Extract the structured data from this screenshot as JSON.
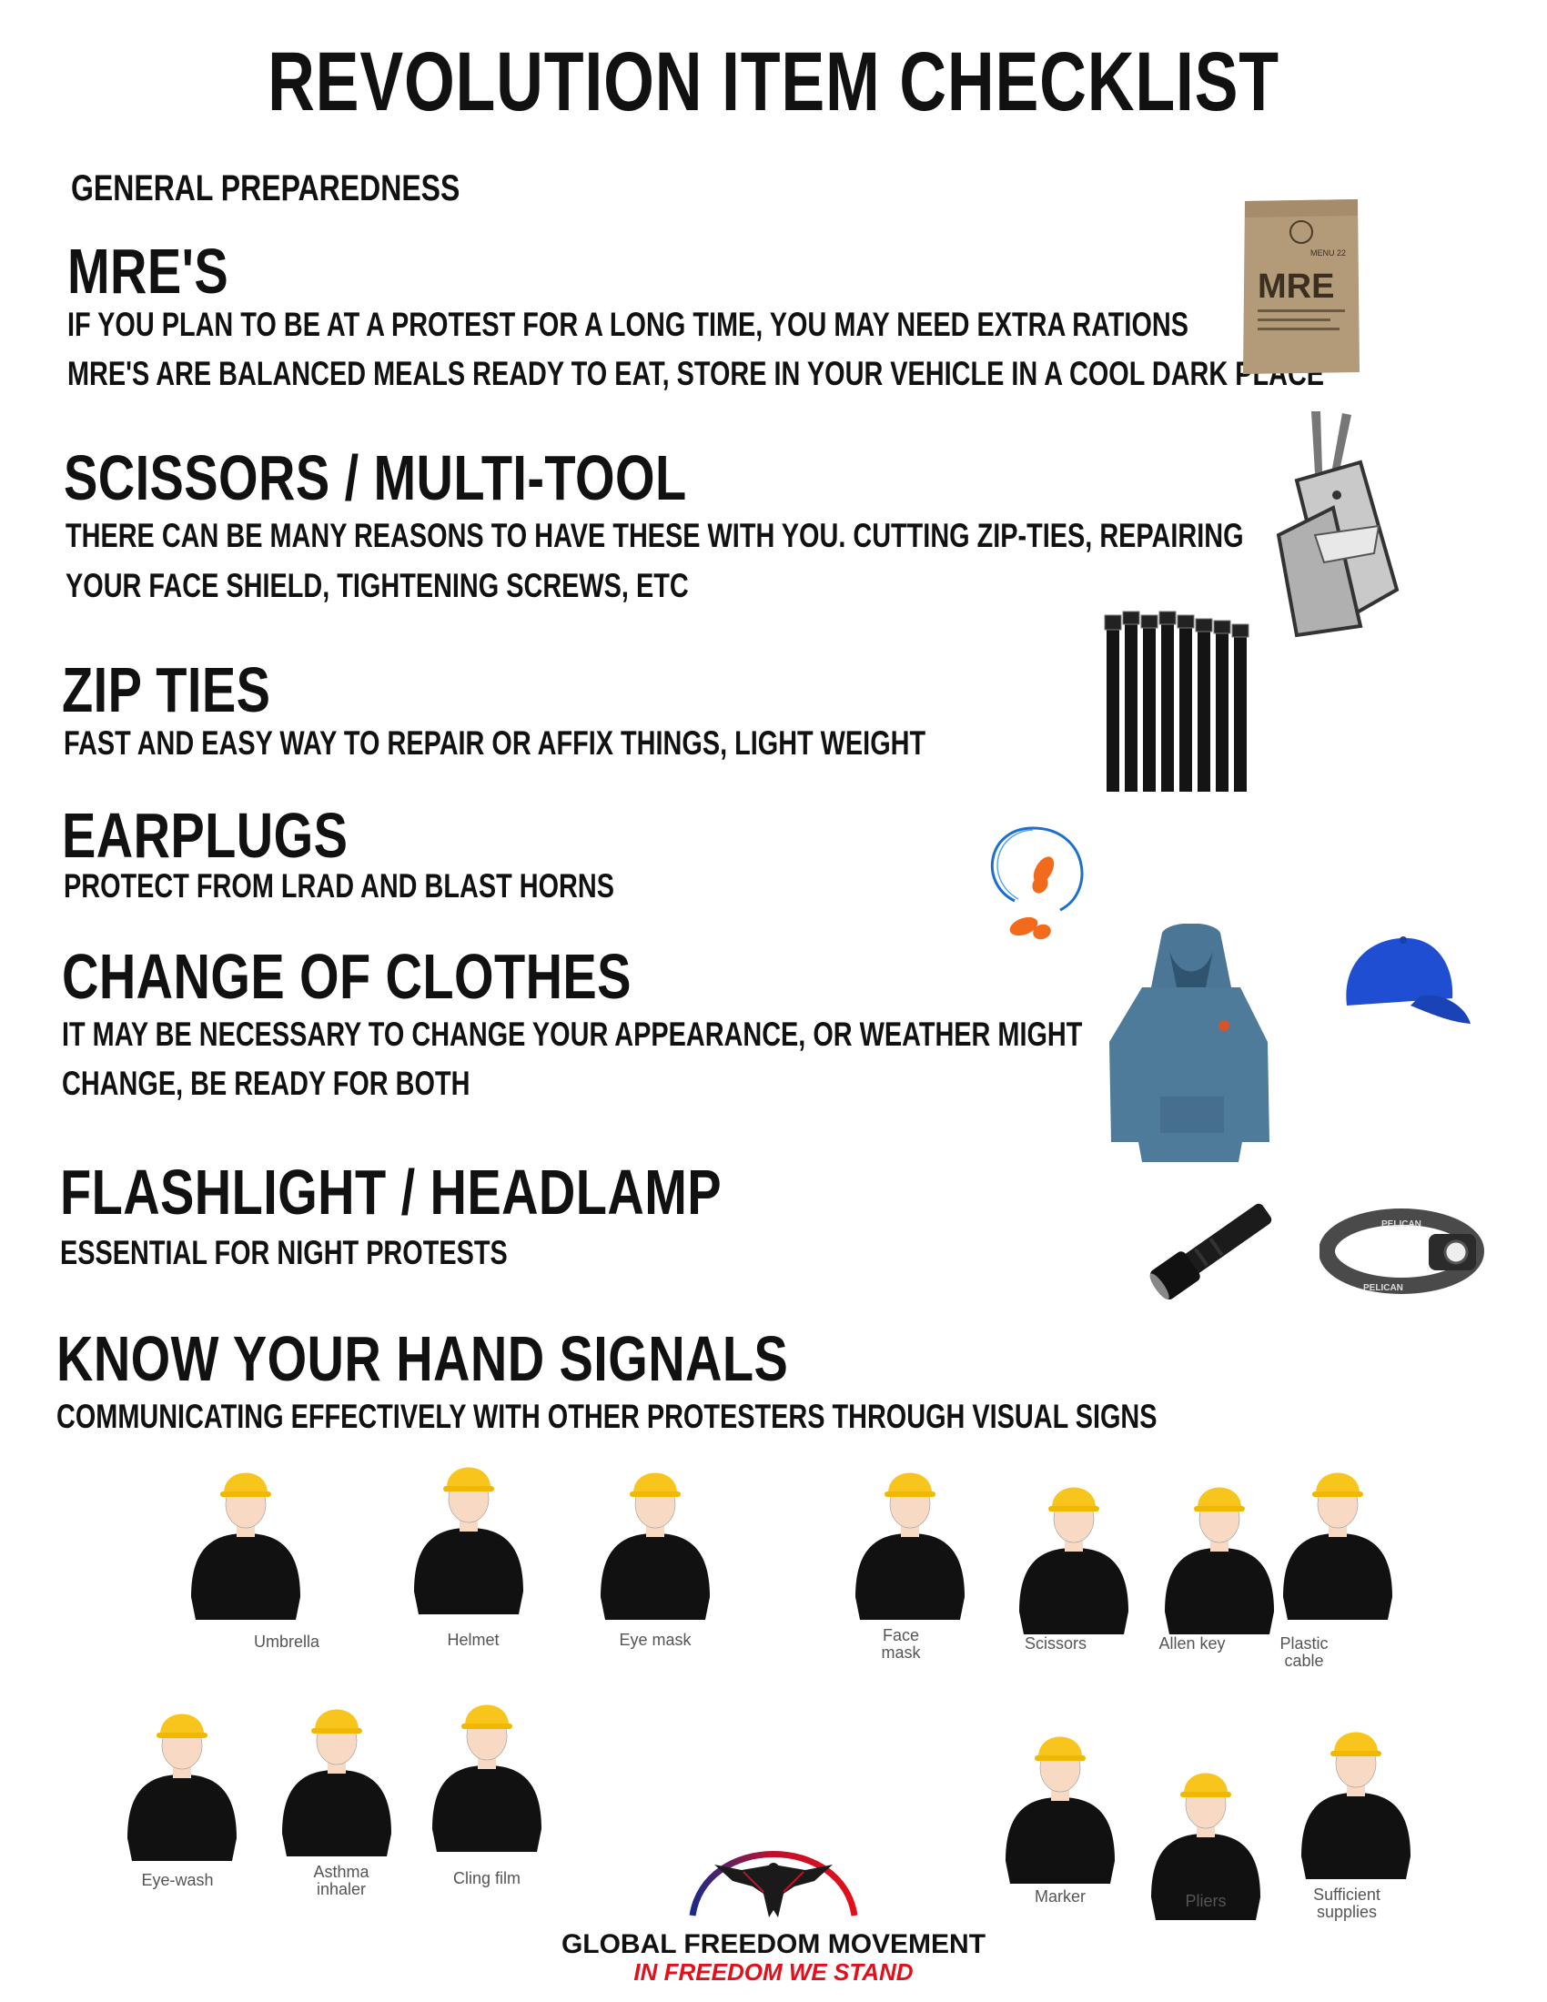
{
  "title": "REVOLUTION ITEM CHECKLIST",
  "section": "GENERAL PREPAREDNESS",
  "items": [
    {
      "heading": "MRE'S",
      "lines": [
        "IF YOU PLAN TO BE AT A PROTEST FOR A LONG TIME, YOU MAY NEED EXTRA RATIONS",
        "MRE'S ARE BALANCED MEALS READY TO EAT, STORE IN YOUR VEHICLE IN A COOL DARK PLACE"
      ]
    },
    {
      "heading": "SCISSORS / MULTI-TOOL",
      "lines": [
        "THERE CAN BE MANY REASONS TO HAVE THESE WITH YOU. CUTTING ZIP-TIES, REPAIRING",
        "YOUR FACE SHIELD, TIGHTENING SCREWS, ETC"
      ]
    },
    {
      "heading": "ZIP TIES",
      "lines": [
        "FAST AND EASY WAY TO REPAIR OR AFFIX THINGS, LIGHT WEIGHT"
      ]
    },
    {
      "heading": "EARPLUGS",
      "lines": [
        "PROTECT FROM LRAD AND BLAST HORNS"
      ]
    },
    {
      "heading": "CHANGE OF CLOTHES",
      "lines": [
        "IT MAY BE NECESSARY TO CHANGE YOUR APPEARANCE, OR WEATHER MIGHT",
        "CHANGE, BE READY FOR BOTH"
      ]
    },
    {
      "heading": "FLASHLIGHT / HEADLAMP",
      "lines": [
        "ESSENTIAL FOR NIGHT PROTESTS"
      ]
    },
    {
      "heading": "KNOW YOUR HAND SIGNALS",
      "lines": [
        "COMMUNICATING EFFECTIVELY WITH OTHER PROTESTERS THROUGH VISUAL SIGNS"
      ]
    }
  ],
  "product_images": {
    "mre_pack_text": "MRE",
    "mre_small": "MENU 22",
    "headlamp_brand": "PELICAN"
  },
  "hand_signals": [
    {
      "label": "Umbrella"
    },
    {
      "label": "Helmet"
    },
    {
      "label": "Eye mask"
    },
    {
      "label": "Face\nmask"
    },
    {
      "label": "Scissors"
    },
    {
      "label": "Allen key"
    },
    {
      "label": "Plastic\ncable"
    },
    {
      "label": "Eye-wash"
    },
    {
      "label": "Asthma\ninhaler"
    },
    {
      "label": "Cling film"
    },
    {
      "label": "Marker"
    },
    {
      "label": "Pliers"
    },
    {
      "label": "Sufficient\nsupplies"
    }
  ],
  "logo": {
    "name": "GLOBAL FREEDOM MOVEMENT",
    "tagline": "IN FREEDOM WE STAND"
  },
  "colors": {
    "helmet": "#f7c51c",
    "shirt": "#111111",
    "skin": "#f7d9c4",
    "accent_red": "#e3101b"
  }
}
